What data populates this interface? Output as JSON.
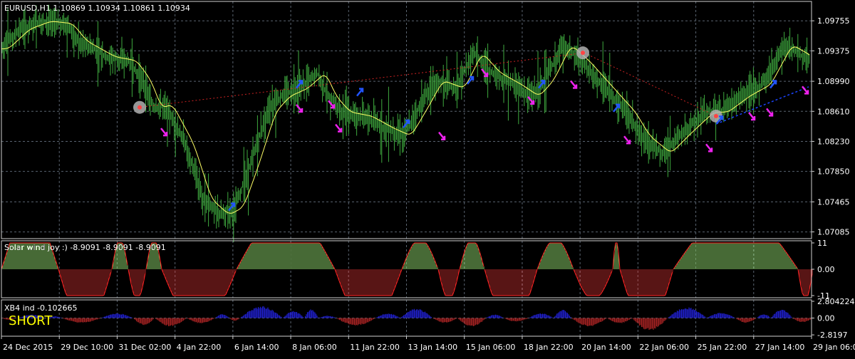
{
  "colors": {
    "background": "#000000",
    "grid": "#5a6470",
    "panel_border": "#d0d0d0",
    "axis_text": "#ffffff",
    "candles": "#3faa3f",
    "ma_line": "#ffff66",
    "trend_line": "#cc2222",
    "trail_line": "#1a44ff",
    "arrow_up": "#2255ff",
    "arrow_down": "#ee22ee",
    "marker_circle": "#b0b0b0",
    "osc_positive": "#8ed36b",
    "osc_negative": "#b02a2a",
    "osc_outline": "#ff2222",
    "xb4_positive": "#1f1fc8",
    "xb4_negative": "#a02222",
    "short_label": "#ffff00"
  },
  "chart_data": [
    {
      "type": "line",
      "title": "EURUSD,H1  1.10869 1.10934 1.10861 1.10934",
      "series_name": "EURUSD,H1",
      "ohlc_last": {
        "open": 1.10869,
        "high": 1.10934,
        "low": 1.10861,
        "close": 1.10934
      },
      "x_tick_labels": [
        "24 Dec 2015",
        "29 Dec 10:00",
        "31 Dec 02:00",
        "4 Jan 22:00",
        "6 Jan 14:00",
        "8 Jan 06:00",
        "11 Jan 22:00",
        "13 Jan 14:00",
        "15 Jan 06:00",
        "18 Jan 22:00",
        "20 Jan 14:00",
        "22 Jan 06:00",
        "25 Jan 22:00",
        "27 Jan 14:00",
        "29 Jan 06:00"
      ],
      "y_tick_labels": [
        "1.09755",
        "1.09375",
        "1.08990",
        "1.08610",
        "1.08230",
        "1.07850",
        "1.07465",
        "1.07085"
      ],
      "y_ticks": [
        1.09755,
        1.09375,
        1.0899,
        1.0861,
        1.0823,
        1.0785,
        1.07465,
        1.07085
      ],
      "ylim": [
        1.07,
        1.1
      ],
      "price_path": [
        [
          0,
          1.094
        ],
        [
          30,
          1.0965
        ],
        [
          60,
          1.0975
        ],
        [
          90,
          1.0972
        ],
        [
          110,
          1.095
        ],
        [
          150,
          1.093
        ],
        [
          180,
          1.0925
        ],
        [
          200,
          1.09
        ],
        [
          215,
          1.0865
        ],
        [
          230,
          1.087
        ],
        [
          260,
          1.082
        ],
        [
          285,
          1.075
        ],
        [
          310,
          1.073
        ],
        [
          330,
          1.074
        ],
        [
          350,
          1.079
        ],
        [
          375,
          1.086
        ],
        [
          395,
          1.088
        ],
        [
          420,
          1.089
        ],
        [
          445,
          1.091
        ],
        [
          460,
          1.088
        ],
        [
          480,
          1.086
        ],
        [
          510,
          1.0855
        ],
        [
          540,
          1.084
        ],
        [
          565,
          1.083
        ],
        [
          585,
          1.086
        ],
        [
          610,
          1.09
        ],
        [
          640,
          1.089
        ],
        [
          665,
          1.0935
        ],
        [
          690,
          1.091
        ],
        [
          720,
          1.0895
        ],
        [
          745,
          1.088
        ],
        [
          765,
          1.09
        ],
        [
          790,
          1.0945
        ],
        [
          815,
          1.0925
        ],
        [
          835,
          1.0905
        ],
        [
          860,
          1.088
        ],
        [
          880,
          1.086
        ],
        [
          900,
          1.083
        ],
        [
          930,
          1.0808
        ],
        [
          960,
          1.0835
        ],
        [
          990,
          1.086
        ],
        [
          1010,
          1.086
        ],
        [
          1040,
          1.088
        ],
        [
          1070,
          1.0895
        ],
        [
          1100,
          1.0945
        ],
        [
          1120,
          1.0935
        ],
        [
          1135,
          1.0925
        ]
      ],
      "trend_line_points": [
        [
          195,
          1.0866
        ],
        [
          820,
          1.0935
        ],
        [
          1005,
          1.0855
        ]
      ],
      "trail_line_points": [
        [
          1005,
          1.0845
        ],
        [
          1135,
          1.0892
        ]
      ],
      "markers": [
        [
          196,
          1.0866
        ],
        [
          818,
          1.0935
        ],
        [
          1005,
          1.0855
        ]
      ],
      "arrows_up": [
        [
          325,
          1.074
        ],
        [
          420,
          1.0895
        ],
        [
          505,
          1.0885
        ],
        [
          570,
          1.0845
        ],
        [
          660,
          1.09
        ],
        [
          760,
          1.0895
        ],
        [
          865,
          1.0865
        ],
        [
          1010,
          1.085
        ],
        [
          1085,
          1.0895
        ]
      ],
      "arrows_down": [
        [
          230,
          1.0835
        ],
        [
          420,
          1.0865
        ],
        [
          465,
          1.087
        ],
        [
          475,
          1.084
        ],
        [
          620,
          1.083
        ],
        [
          680,
          1.091
        ],
        [
          745,
          1.0875
        ],
        [
          805,
          1.0895
        ],
        [
          880,
          1.0825
        ],
        [
          995,
          1.0815
        ],
        [
          1055,
          1.0855
        ],
        [
          1080,
          1.086
        ],
        [
          1130,
          1.0888
        ]
      ]
    },
    {
      "type": "area",
      "title": "Solar wind joy :) -8.9091 -8.9091 -8.9091",
      "series_name": "Solar wind joy :)",
      "values_shown": [
        -8.9091,
        -8.9091,
        -8.9091
      ],
      "y_tick_labels": [
        "11",
        "0.00",
        "-11"
      ],
      "ylim": [
        -11,
        11
      ],
      "segments": [
        {
          "sign": 1,
          "from": 0,
          "to": 80
        },
        {
          "sign": -1,
          "from": 80,
          "to": 155
        },
        {
          "sign": 1,
          "from": 155,
          "to": 178
        },
        {
          "sign": -1,
          "from": 178,
          "to": 203
        },
        {
          "sign": 1,
          "from": 203,
          "to": 225
        },
        {
          "sign": -1,
          "from": 225,
          "to": 330
        },
        {
          "sign": 1,
          "from": 330,
          "to": 468
        },
        {
          "sign": -1,
          "from": 468,
          "to": 562
        },
        {
          "sign": 1,
          "from": 562,
          "to": 613
        },
        {
          "sign": -1,
          "from": 613,
          "to": 643
        },
        {
          "sign": 1,
          "from": 643,
          "to": 678
        },
        {
          "sign": -1,
          "from": 678,
          "to": 752
        },
        {
          "sign": 1,
          "from": 752,
          "to": 803
        },
        {
          "sign": -1,
          "from": 803,
          "to": 858
        },
        {
          "sign": 1,
          "from": 858,
          "to": 868
        },
        {
          "sign": -1,
          "from": 868,
          "to": 943
        },
        {
          "sign": 1,
          "from": 943,
          "to": 1118
        },
        {
          "sign": -1,
          "from": 1118,
          "to": 1139
        }
      ]
    },
    {
      "type": "bar",
      "title": "XB4 ind -0.102665",
      "series_name": "XB4 ind",
      "value_shown": -0.102665,
      "y_tick_labels": [
        "2.804224",
        "0.00",
        "-2.8197"
      ],
      "ylim": [
        -2.8197,
        2.804224
      ],
      "signal_label": "SHORT",
      "lobes": [
        [
          0,
          20,
          -0.3
        ],
        [
          25,
          60,
          0.6
        ],
        [
          65,
          85,
          0.3
        ],
        [
          85,
          140,
          -0.8
        ],
        [
          140,
          185,
          0.8
        ],
        [
          185,
          215,
          -1.2
        ],
        [
          215,
          260,
          -1.4
        ],
        [
          260,
          300,
          -0.9
        ],
        [
          300,
          320,
          0.7
        ],
        [
          320,
          335,
          -0.5
        ],
        [
          335,
          395,
          2.0
        ],
        [
          395,
          425,
          1.2
        ],
        [
          425,
          445,
          1.5
        ],
        [
          445,
          470,
          0.4
        ],
        [
          470,
          525,
          -1.3
        ],
        [
          525,
          560,
          0.8
        ],
        [
          560,
          605,
          1.6
        ],
        [
          605,
          640,
          -0.8
        ],
        [
          640,
          680,
          -1.5
        ],
        [
          680,
          705,
          0.6
        ],
        [
          705,
          740,
          -0.6
        ],
        [
          740,
          775,
          0.8
        ],
        [
          775,
          800,
          1.4
        ],
        [
          800,
          850,
          -1.4
        ],
        [
          850,
          885,
          -0.9
        ],
        [
          885,
          935,
          -2.1
        ],
        [
          935,
          990,
          1.8
        ],
        [
          990,
          1030,
          0.9
        ],
        [
          1030,
          1060,
          -0.8
        ],
        [
          1060,
          1080,
          0.7
        ],
        [
          1080,
          1110,
          1.5
        ],
        [
          1110,
          1139,
          -0.7
        ]
      ]
    }
  ]
}
